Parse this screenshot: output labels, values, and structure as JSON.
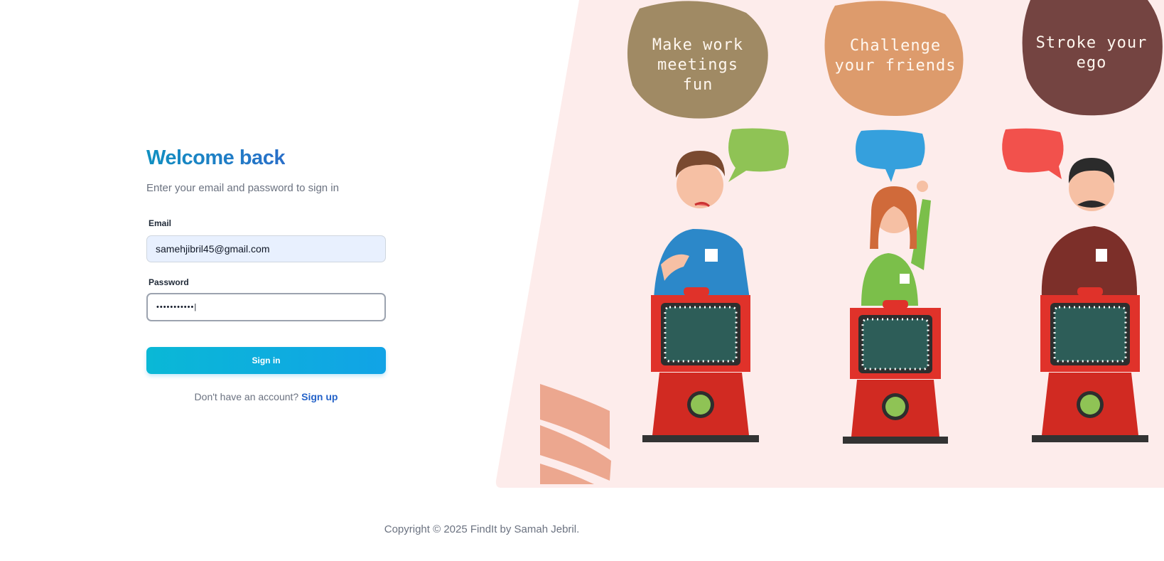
{
  "signin": {
    "title": "Welcome back",
    "subtitle": "Enter your email and password to sign in",
    "email_label": "Email",
    "email_value": "samehjibril45@gmail.com",
    "password_label": "Password",
    "password_value": "•••••••••••|",
    "button_label": "Sign in",
    "no_account_text": "Don't have an account?",
    "signup_link": "Sign up"
  },
  "illustration": {
    "bubble_left": [
      "Make work",
      "meetings",
      "fun"
    ],
    "bubble_middle": [
      "Challenge",
      "your friends"
    ],
    "bubble_right": [
      "Stroke your",
      "ego"
    ],
    "colors": {
      "panel_bg": "#fdeceb",
      "bubble_left": "#a08a64",
      "bubble_middle": "#dd9b6c",
      "bubble_right": "#744441",
      "podium_red": "#e0322a"
    }
  },
  "footer": {
    "copyright": "Copyright © 2025 FindIt by Samah Jebril."
  }
}
